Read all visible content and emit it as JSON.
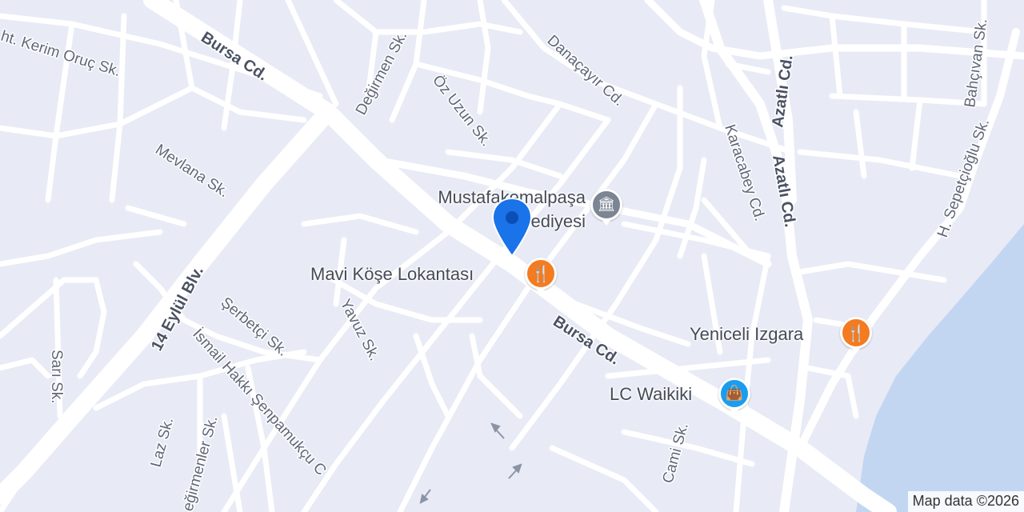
{
  "map": {
    "colors": {
      "background": "#e8ebf5",
      "road": "#ffffff",
      "water": "#c2d6f2",
      "restaurant": "#f47b20",
      "shopping": "#1a9df0",
      "government": "#7b8593",
      "marker": "#1a73e8"
    },
    "streets": [
      {
        "label": "Bursa Cd."
      },
      {
        "label": "Bursa Cd."
      },
      {
        "label": "Değirmen Sk."
      },
      {
        "label": "Öz Uzun Sk."
      },
      {
        "label": "Danaçayır Cd."
      },
      {
        "label": "Azatlı Cd."
      },
      {
        "label": "Azatlı Cd."
      },
      {
        "label": "Bahçıvan Sk."
      },
      {
        "label": "Karacabey Cd."
      },
      {
        "label": "H. Sepetçioğlu Sk."
      },
      {
        "label": "Mevlana Sk."
      },
      {
        "label": "ht. Kerim Oruç Sk."
      },
      {
        "label": "14 Eylül Blv."
      },
      {
        "label": "Şerbetçi Sk."
      },
      {
        "label": "Yavuz Sk."
      },
      {
        "label": "İsmail Hakkı Şenpamukçu C"
      },
      {
        "label": "Sarı Sk."
      },
      {
        "label": "Laz Sk."
      },
      {
        "label": "eğirmenler Sk."
      },
      {
        "label": "Cami Sk."
      }
    ],
    "pois": [
      {
        "label": "Mustafakemalpaşa Belediyesi",
        "icon": "government-building-icon"
      },
      {
        "label": "Mavi Köşe Lokantası",
        "icon": "restaurant-fork-knife-icon"
      },
      {
        "label": "Yeniceli Izgara",
        "icon": "restaurant-fork-knife-icon"
      },
      {
        "label": "LC Waikiki",
        "icon": "shopping-bag-icon"
      }
    ],
    "marker": {
      "icon": "location-pin-icon"
    },
    "attribution": "Map data ©2026"
  }
}
